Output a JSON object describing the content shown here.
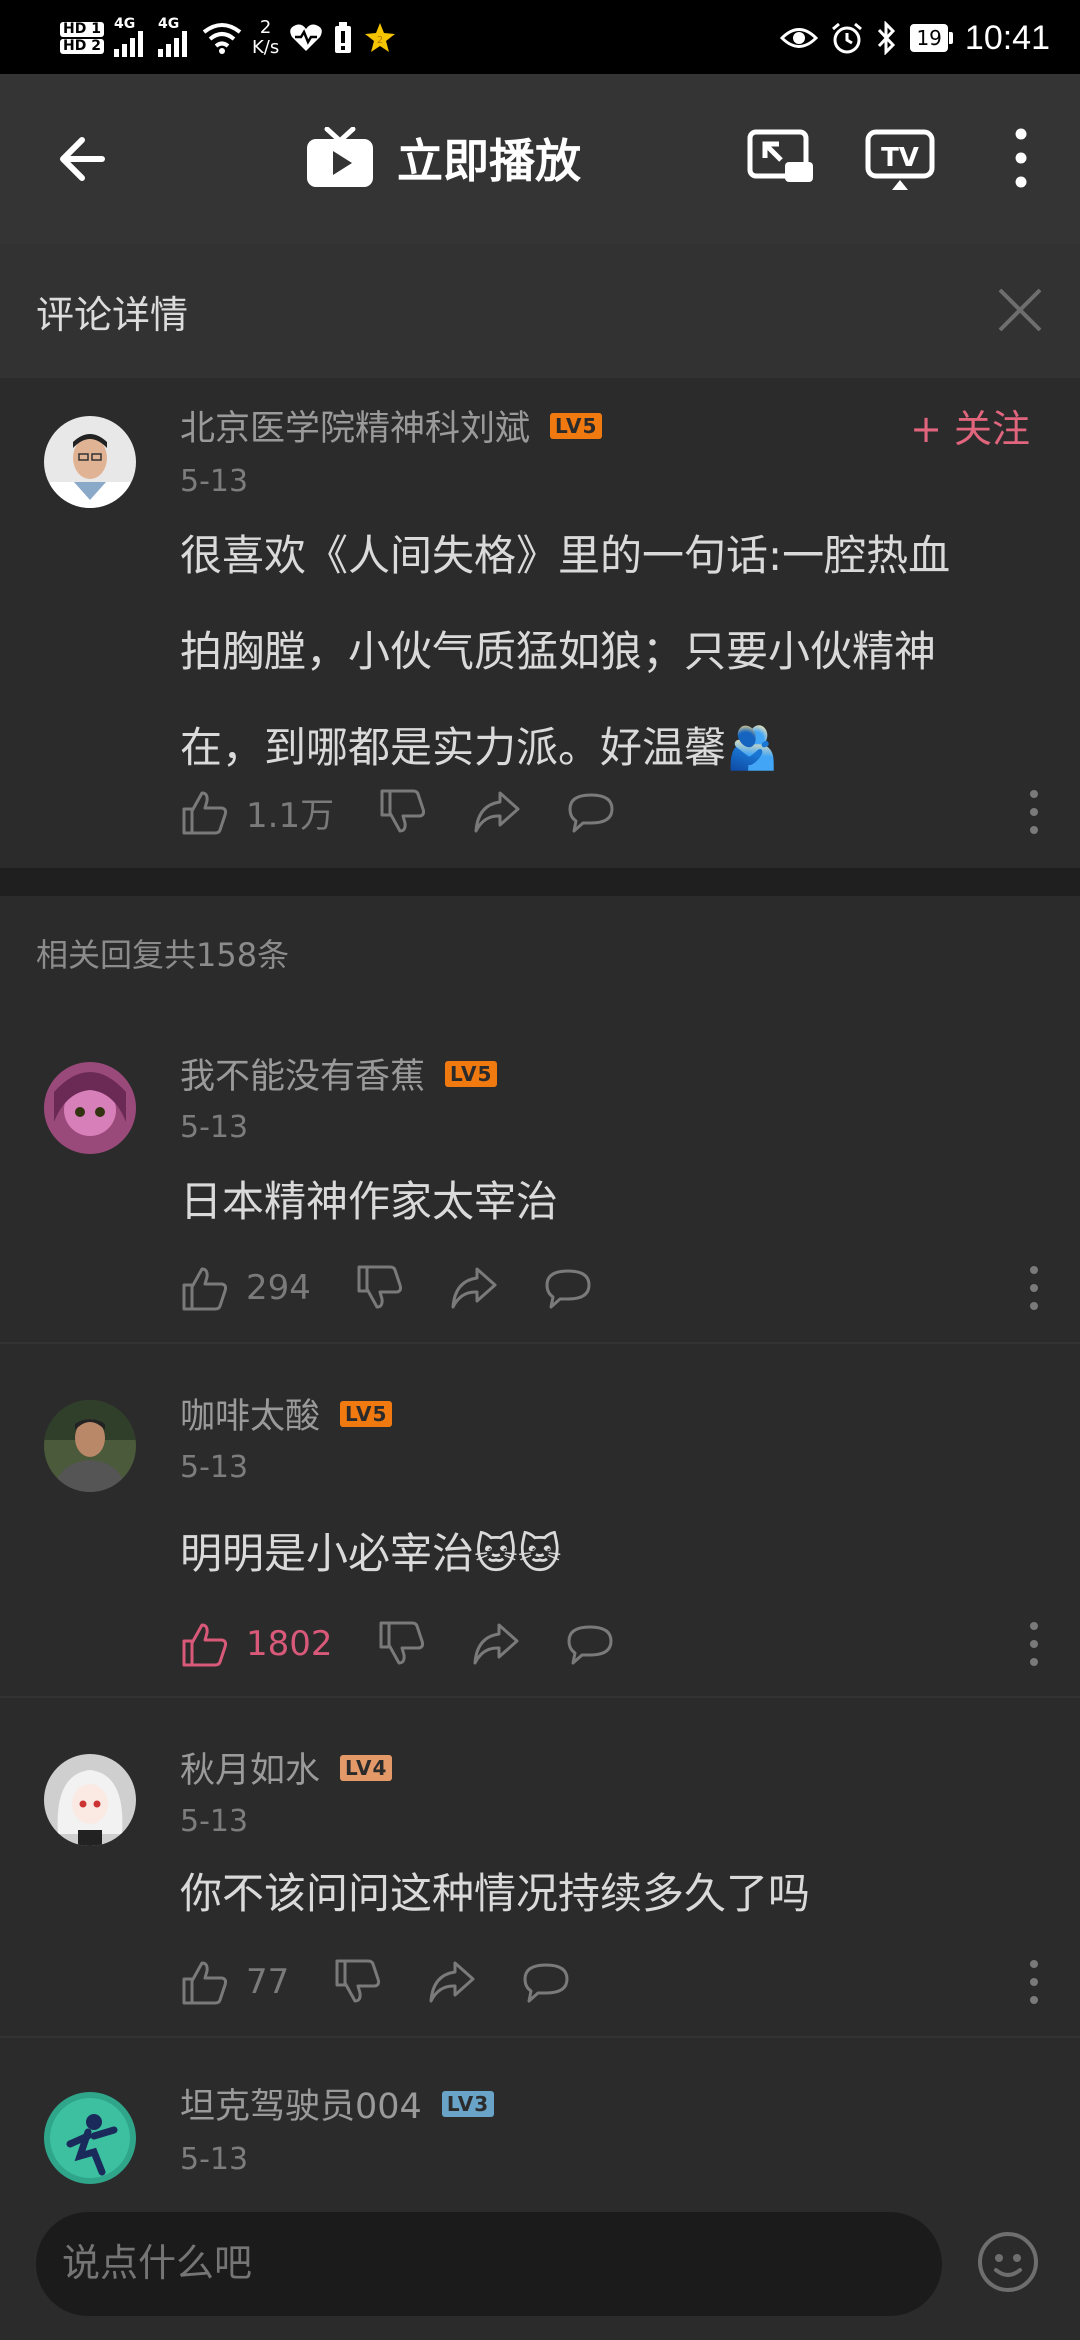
{
  "status_bar": {
    "hd1": "HD 1",
    "hd2": "HD 2",
    "net1": "4G",
    "net2": "4G",
    "speed_value": "2",
    "speed_unit": "K/s",
    "battery": "19",
    "time": "10:41"
  },
  "app_bar": {
    "title": "立即播放"
  },
  "section": {
    "title": "评论详情"
  },
  "main_comment": {
    "username": "北京医学院精神科刘斌",
    "level": "LV5",
    "follow_label": "+ 关注",
    "date": "5-13",
    "lines": [
      "很喜欢《人间失格》里的一句话:一腔热血",
      "拍胸膛，小伙气质猛如狼；只要小伙精神",
      "在，到哪都是实力派。好温馨🫂"
    ],
    "likes": "1.1万"
  },
  "replies_header": "相关回复共158条",
  "replies": [
    {
      "username": "我不能没有香蕉",
      "level": "LV5",
      "date": "5-13",
      "text": "日本精神作家太宰治",
      "likes": "294",
      "liked": false
    },
    {
      "username": "咖啡太酸",
      "level": "LV5",
      "date": "5-13",
      "text": "明明是小必宰治🐱🐱",
      "likes": "1802",
      "liked": true
    },
    {
      "username": "秋月如水",
      "level": "LV4",
      "date": "5-13",
      "text": "你不该问问这种情况持续多久了吗",
      "likes": "77",
      "liked": false
    },
    {
      "username": "坦克驾驶员004",
      "level": "LV3",
      "date": "5-13",
      "text": "",
      "likes": "",
      "liked": false
    }
  ],
  "input": {
    "placeholder": "说点什么吧"
  },
  "colors": {
    "background": "#2b2b2b",
    "accent_pink": "#e2657e",
    "level5": "#f07a10",
    "level4": "#e39a68",
    "level3": "#6aa3c8"
  }
}
